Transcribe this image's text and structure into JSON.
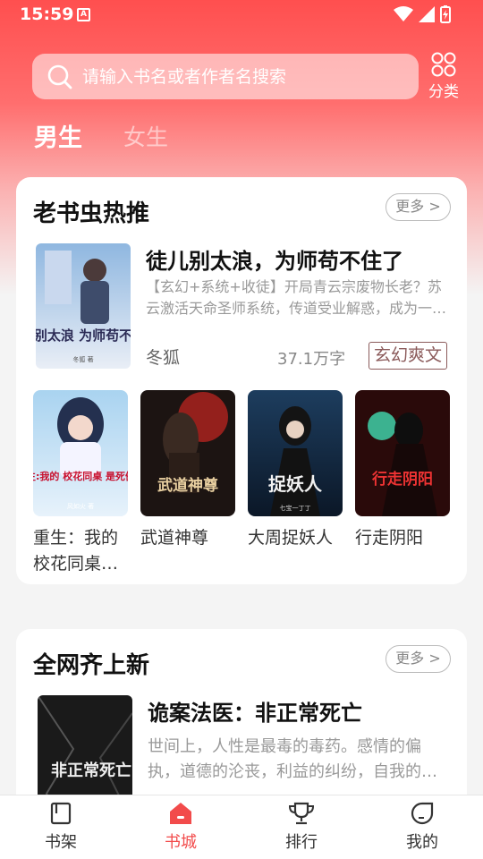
{
  "status_bar": {
    "time": "15:59",
    "notification_icon": "A"
  },
  "search": {
    "placeholder": "请输入书名或者作者名搜索"
  },
  "category": {
    "label": "分类"
  },
  "gender_tabs": [
    {
      "label": "男生",
      "selected": true
    },
    {
      "label": "女生",
      "selected": false
    }
  ],
  "hot_section": {
    "title": "老书虫热推",
    "more_label": "更多 >",
    "featured": {
      "title": "徒儿别太浪，为师苟不住了",
      "description": "【玄幻+系统+收徒】开局青云宗废物长老？苏云激活天命圣师系统，传道受业解惑，成为一代宗师！",
      "author": "冬狐",
      "word_count": "37.1万字",
      "tag": "玄幻爽文",
      "cover_text": "徒儿别太浪 为师苟不住了",
      "cover_author": "冬狐 著"
    },
    "books": [
      {
        "title": "重生：我的校花同桌是死傲娇",
        "cover_text": "重生:我的 校花同桌 是死傲娇",
        "cover_author": "风如火 著"
      },
      {
        "title": "武道神尊",
        "cover_text": "武道神尊",
        "cover_author": ""
      },
      {
        "title": "大周捉妖人",
        "cover_text": "捉妖人",
        "cover_author": "七宝一丁丁"
      },
      {
        "title": "行走阴阳",
        "cover_text": "行走阴阳",
        "cover_author": ""
      }
    ]
  },
  "new_section": {
    "title": "全网齐上新",
    "more_label": "更多 >",
    "featured": {
      "title": "诡案法医：非正常死亡",
      "description": "世间上，人性是最毒的毒药。感情的偏执，道德的沦丧，利益的纠纷，自我的迷失……",
      "cover_text": "非正常死亡"
    }
  },
  "bottom_nav": [
    {
      "label": "书架",
      "icon": "bookshelf-icon",
      "active": false
    },
    {
      "label": "书城",
      "icon": "bookstore-home-icon",
      "active": true
    },
    {
      "label": "排行",
      "icon": "trophy-icon",
      "active": false
    },
    {
      "label": "我的",
      "icon": "profile-icon",
      "active": false
    }
  ],
  "colors": {
    "accent": "#f24b4b",
    "header_red": "#ff4f4f",
    "tag_brown": "#8b5a5a"
  }
}
